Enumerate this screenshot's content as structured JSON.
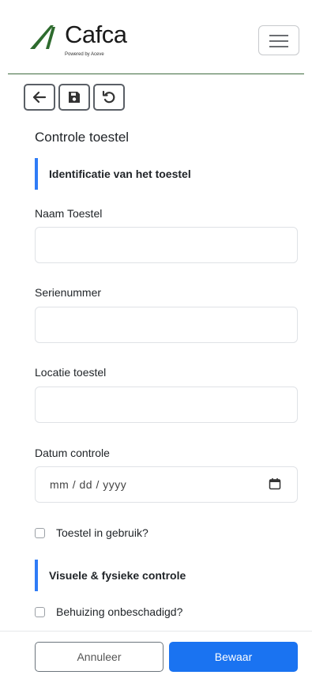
{
  "brand": {
    "name": "Cafca",
    "tagline": "Powered by Aceve",
    "logo_color": "#2e6b2e"
  },
  "toolbar": {
    "back_icon": "arrow-left-icon",
    "save_icon": "floppy-disk-icon",
    "reset_icon": "undo-icon"
  },
  "page": {
    "title": "Controle toestel"
  },
  "sections": [
    {
      "title": "Identificatie van het toestel"
    },
    {
      "title": "Visuele & fysieke controle"
    }
  ],
  "fields": {
    "naam": {
      "label": "Naam Toestel",
      "value": ""
    },
    "serienummer": {
      "label": "Serienummer",
      "value": ""
    },
    "locatie": {
      "label": "Locatie toestel",
      "value": ""
    },
    "datum": {
      "label": "Datum controle",
      "placeholder": "mm / dd / yyyy"
    }
  },
  "checkboxes": {
    "in_gebruik": {
      "label": "Toestel in gebruik?",
      "checked": false
    },
    "behuizing": {
      "label": "Behuizing onbeschadigd?",
      "checked": false
    }
  },
  "footer": {
    "cancel_label": "Annuleer",
    "save_label": "Bewaar"
  },
  "colors": {
    "accent": "#1a73f1",
    "section_bar": "#2f7cf6",
    "divider": "#3f6b3f"
  }
}
